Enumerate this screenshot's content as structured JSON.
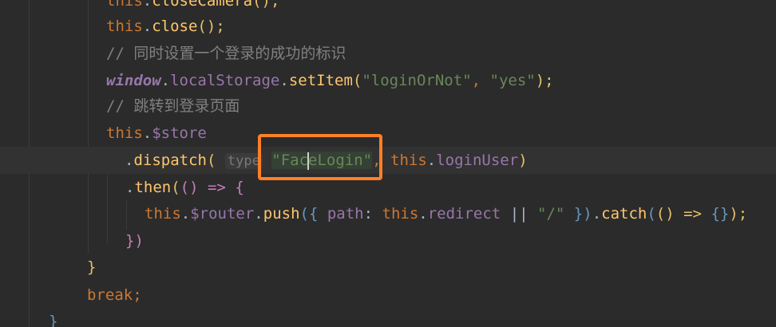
{
  "code": {
    "line0": {
      "this": "this",
      "dot": ".",
      "method": "closeCamera",
      "tail": "();"
    },
    "line1": {
      "this": "this",
      "dot": ".",
      "method": "close",
      "tail": "();"
    },
    "line2": {
      "comment": "// 同时设置一个登录的成功的标识"
    },
    "line3": {
      "window": "window",
      "dot1": ".",
      "prop": "localStorage",
      "dot2": ".",
      "method": "setItem",
      "open": "(",
      "arg1": "\"loginOrNot\"",
      "comma": ", ",
      "arg2": "\"yes\"",
      "close": ");"
    },
    "line4": {
      "comment": "// 跳转到登录页面"
    },
    "line5": {
      "this": "this",
      "dot": ".",
      "prop": "$store"
    },
    "line6": {
      "dot": ".",
      "method": "dispatch",
      "open": "(",
      "hint": "type",
      "arg_a": "\"Fac",
      "arg_b": "eLogin\"",
      "comma": ", ",
      "this": "this",
      "dot2": ".",
      "prop": "loginUser",
      "close": ")"
    },
    "line7": {
      "dot": ".",
      "method": "then",
      "open": "(",
      "params": "() => ",
      "brace": "{"
    },
    "line8": {
      "this": "this",
      "dot": ".",
      "prop": "$router",
      "dot2": ".",
      "method": "push",
      "open": "(",
      "brace_open": "{ ",
      "key": "path",
      "colon": ": ",
      "this2": "this",
      "dot3": ".",
      "prop2": "redirect",
      "or": " || ",
      "str": "\"/\"",
      "brace_close": " }",
      "close": ")",
      "dot4": ".",
      "method2": "catch",
      "open2": "(",
      "arrow": "() => ",
      "empty": "{}",
      "close2": ");"
    },
    "line9": {
      "close": "})"
    },
    "line10": {
      "brace": "}"
    },
    "line11": {
      "kw": "break",
      "semi": ";"
    },
    "line12": {
      "brace": "}"
    }
  },
  "colors": {
    "background": "#2b2b2b",
    "highlight_box": "#ff7f27",
    "keyword": "#cc7832",
    "string": "#6a8759",
    "function": "#ffc66d",
    "property": "#9876aa",
    "comment": "#808080"
  }
}
